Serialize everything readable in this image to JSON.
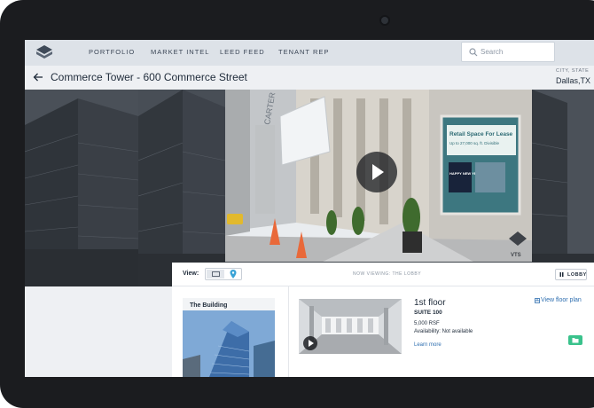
{
  "nav": {
    "items": [
      "PORTFOLIO",
      "MARKET INTEL",
      "LEED FEED",
      "TENANT REP"
    ],
    "search_placeholder": "Search"
  },
  "header": {
    "title": "Commerce Tower - 600 Commerce Street",
    "location_label": "CITY, STATE",
    "location_value": "Dallas,TX"
  },
  "video": {
    "sign_text": "Retail Space For Lease",
    "sign_sub": "Up to 27,000 sq. ft. Divisible",
    "poster_text": "HAPPY NEW YEAR!",
    "building_sign": "CARTER",
    "watermark": "VTS"
  },
  "viewer": {
    "view_label": "View:",
    "now_viewing": "NOW VIEWING: THE LOBBY",
    "lobby_button": "LOBBY"
  },
  "building_card": {
    "title": "The Building"
  },
  "floor": {
    "name": "1st floor",
    "suite": "SUITE 100",
    "rsf": "5,000 RSF",
    "availability": "Availability: Not available",
    "learn_more": "Learn more",
    "floor_plan_link": "View floor plan"
  },
  "colors": {
    "accent": "#2f6fb0",
    "green": "#3ac28c",
    "nav_bg": "#dde2e8"
  }
}
